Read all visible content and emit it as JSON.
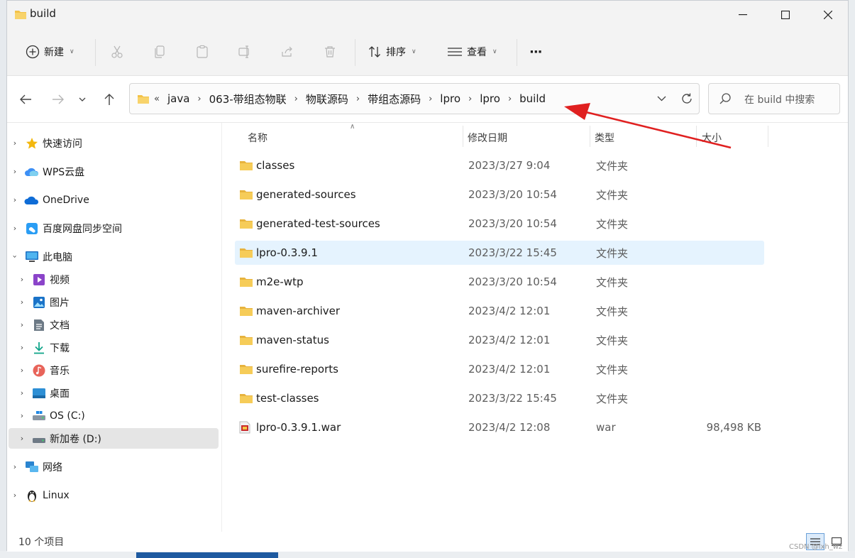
{
  "window": {
    "title": "build"
  },
  "toolbar": {
    "new_label": "新建",
    "sort_label": "排序",
    "view_label": "查看",
    "more_label": "···"
  },
  "address": {
    "overflow": "«",
    "crumbs": [
      "java",
      "063-带组态物联",
      "物联源码",
      "带组态源码",
      "lpro",
      "lpro",
      "build"
    ]
  },
  "search": {
    "placeholder": "在 build 中搜索"
  },
  "sidebar": {
    "items": [
      {
        "label": "快速访问",
        "icon": "star-icon"
      },
      {
        "label": "WPS云盘",
        "icon": "cloud-icon"
      },
      {
        "label": "OneDrive",
        "icon": "onedrive-icon"
      },
      {
        "label": "百度网盘同步空间",
        "icon": "baidu-icon"
      },
      {
        "label": "此电脑",
        "icon": "computer-icon"
      },
      {
        "label": "视频",
        "icon": "video-icon"
      },
      {
        "label": "图片",
        "icon": "picture-icon"
      },
      {
        "label": "文档",
        "icon": "document-icon"
      },
      {
        "label": "下载",
        "icon": "download-icon"
      },
      {
        "label": "音乐",
        "icon": "music-icon"
      },
      {
        "label": "桌面",
        "icon": "desktop-icon"
      },
      {
        "label": "OS (C:)",
        "icon": "drive-icon"
      },
      {
        "label": "新加卷 (D:)",
        "icon": "drive-icon"
      },
      {
        "label": "网络",
        "icon": "network-icon"
      },
      {
        "label": "Linux",
        "icon": "linux-icon"
      }
    ]
  },
  "columns": {
    "name": "名称",
    "date": "修改日期",
    "type": "类型",
    "size": "大小"
  },
  "files": [
    {
      "name": "classes",
      "date": "2023/3/27 9:04",
      "type": "文件夹",
      "size": ""
    },
    {
      "name": "generated-sources",
      "date": "2023/3/20 10:54",
      "type": "文件夹",
      "size": ""
    },
    {
      "name": "generated-test-sources",
      "date": "2023/3/20 10:54",
      "type": "文件夹",
      "size": ""
    },
    {
      "name": "lpro-0.3.9.1",
      "date": "2023/3/22 15:45",
      "type": "文件夹",
      "size": ""
    },
    {
      "name": "m2e-wtp",
      "date": "2023/3/20 10:54",
      "type": "文件夹",
      "size": ""
    },
    {
      "name": "maven-archiver",
      "date": "2023/4/2 12:01",
      "type": "文件夹",
      "size": ""
    },
    {
      "name": "maven-status",
      "date": "2023/4/2 12:01",
      "type": "文件夹",
      "size": ""
    },
    {
      "name": "surefire-reports",
      "date": "2023/4/2 12:01",
      "type": "文件夹",
      "size": ""
    },
    {
      "name": "test-classes",
      "date": "2023/3/22 15:45",
      "type": "文件夹",
      "size": ""
    },
    {
      "name": "lpro-0.3.9.1.war",
      "date": "2023/4/2 12:08",
      "type": "war",
      "size": "98,498 KB"
    }
  ],
  "status": {
    "count_text": "10 个项目"
  },
  "watermark": "CSDN @lxh_wz",
  "colors": {
    "folder": "#f3c247",
    "annotation_arrow": "#e02020",
    "hover_row": "#e5f3fe",
    "selected_side": "#e5e5e5"
  }
}
